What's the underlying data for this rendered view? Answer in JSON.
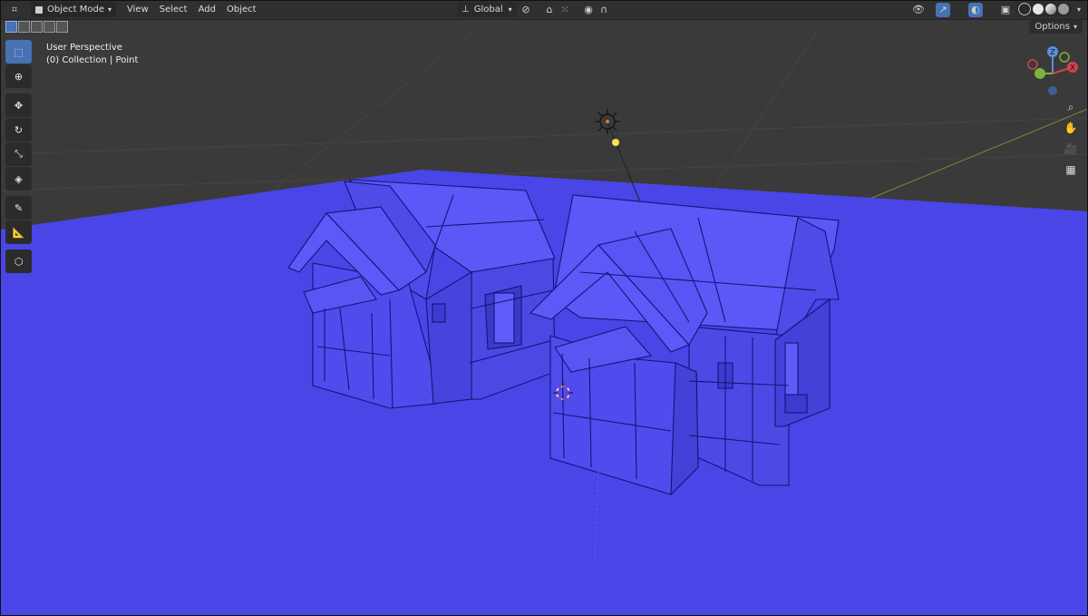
{
  "header": {
    "mode_label": "Object Mode",
    "menu": [
      "View",
      "Select",
      "Add",
      "Object"
    ],
    "orientation_label": "Global"
  },
  "options_label": "Options",
  "viewport": {
    "perspective_label": "User Perspective",
    "collection_label": "(0) Collection | Point"
  },
  "toolbar": {
    "tools": [
      "select-box-icon",
      "cursor-icon",
      "move-icon",
      "rotate-icon",
      "scale-icon",
      "transform-icon",
      "annotate-icon",
      "measure-icon",
      "add-cube-icon"
    ],
    "active_tool": "select-box-icon"
  },
  "gizmo": {
    "x_label": "X",
    "y_label": "Y",
    "z_label": "Z"
  },
  "colors": {
    "ground": "#4a45e6",
    "house": "#4f4ef0",
    "header": "#303030",
    "background": "#3a3a3a",
    "accent": "#4772b3"
  }
}
